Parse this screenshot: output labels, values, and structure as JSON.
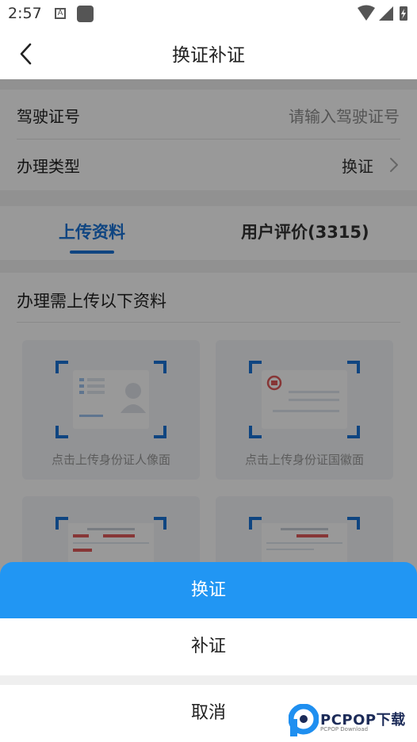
{
  "status_bar": {
    "time": "2:57",
    "notification_icon_text": "A"
  },
  "header": {
    "title": "换证补证"
  },
  "form": {
    "license_label": "驾驶证号",
    "license_placeholder": "请输入驾驶证号",
    "type_label": "办理类型",
    "type_value": "换证"
  },
  "tabs": [
    {
      "label": "上传资料",
      "active": true
    },
    {
      "label": "用户评价(3315)",
      "active": false
    }
  ],
  "section": {
    "title": "办理需上传以下资料",
    "cards": [
      {
        "caption": "点击上传身份证人像面"
      },
      {
        "caption": "点击上传身份证国徽面"
      },
      {
        "caption": ""
      },
      {
        "caption": ""
      }
    ]
  },
  "sheet": {
    "options": [
      "换证",
      "补证"
    ],
    "cancel": "取消"
  },
  "watermark": {
    "brand": "PCPOP下载",
    "sub": "PCPOP Download"
  },
  "colors": {
    "accent": "#2196f3",
    "tab_active": "#1a73d8",
    "frame": "#1a73d8"
  }
}
